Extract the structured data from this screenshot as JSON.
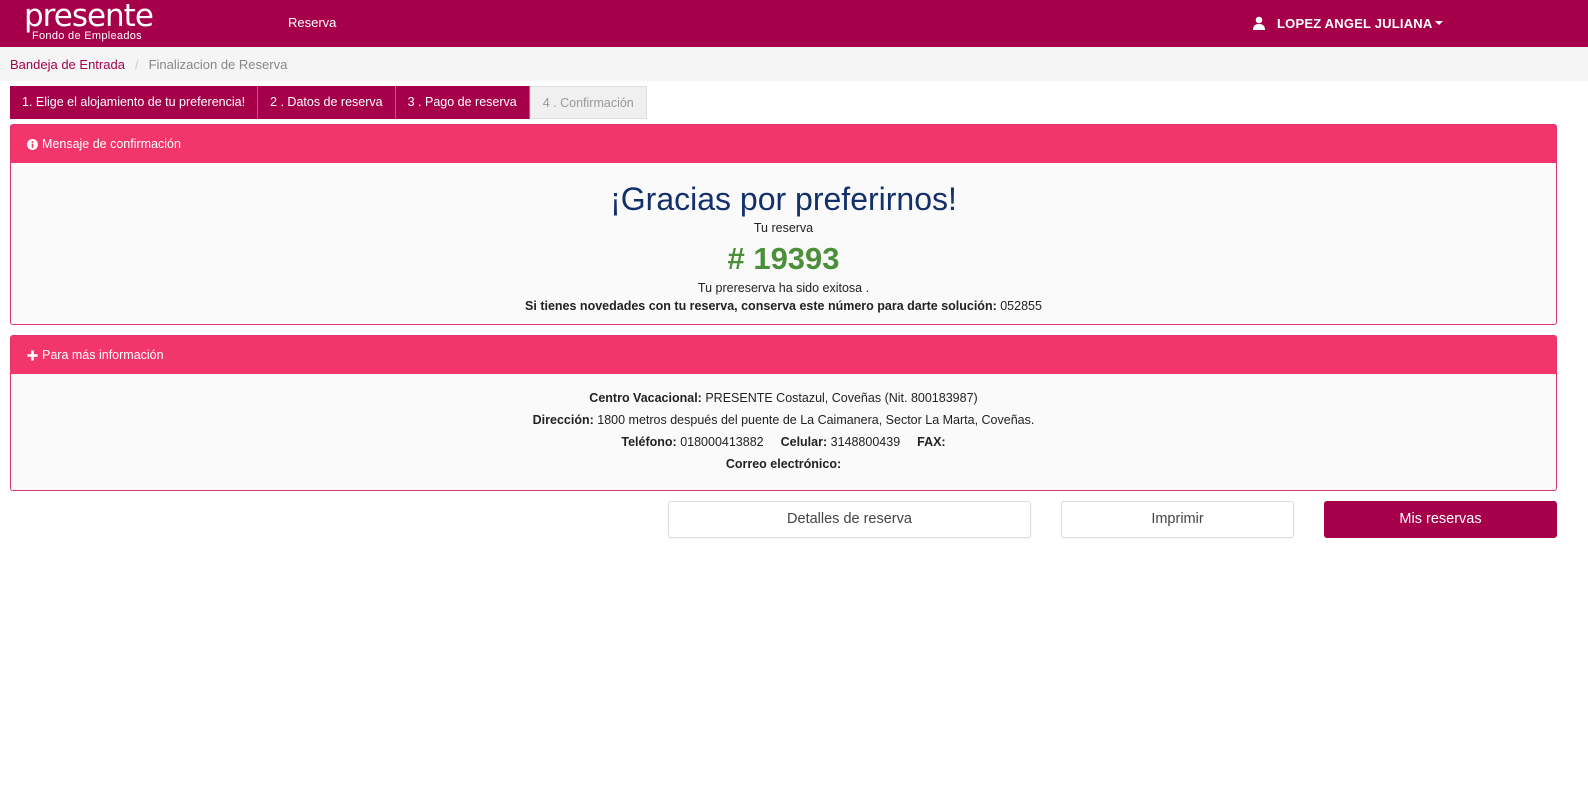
{
  "navbar": {
    "logo_main": "presente",
    "logo_sub": "Fondo de Empleados",
    "nav_link": "Reserva",
    "user_name": "LOPEZ ANGEL JULIANA"
  },
  "breadcrumb": {
    "home": "Bandeja de Entrada",
    "current": "Finalizacion de Reserva"
  },
  "steps": [
    {
      "label": "1. Elige el alojamiento de tu preferencia!"
    },
    {
      "label": "2 . Datos de reserva"
    },
    {
      "label": "3 . Pago de reserva"
    },
    {
      "label": "4 . Confirmación"
    }
  ],
  "confirmation": {
    "heading": "Mensaje de confirmación",
    "thanks": "¡Gracias por preferirnos!",
    "tu_reserva": "Tu reserva",
    "number": "# 19393",
    "success": "Tu prereserva ha sido exitosa .",
    "novedades_label": "Si tienes novedades con tu reserva, conserva este número para darte solución:",
    "novedades_code": "052855"
  },
  "info": {
    "heading": "Para más información",
    "centro_label": "Centro Vacacional:",
    "centro_value": "PRESENTE Costazul, Coveñas (Nit. 800183987)",
    "direccion_label": "Dirección:",
    "direccion_value": "1800 metros después del puente de La Caimanera, Sector La Marta, Coveñas.",
    "telefono_label": "Teléfono:",
    "telefono_value": "018000413882",
    "celular_label": "Celular:",
    "celular_value": "3148800439",
    "fax_label": "FAX:",
    "correo_label": "Correo electrónico:"
  },
  "buttons": {
    "detalles": "Detalles de reserva",
    "imprimir": "Imprimir",
    "mis_reservas": "Mis reservas"
  },
  "icons": {
    "user": "user-icon",
    "info": "info-circle-icon",
    "plus": "plus-icon",
    "caret": "caret-down-icon"
  },
  "colors": {
    "brand": "#a6004a",
    "panel_heading": "#f2366c",
    "title": "#13306b",
    "number": "#4b8f3b"
  }
}
